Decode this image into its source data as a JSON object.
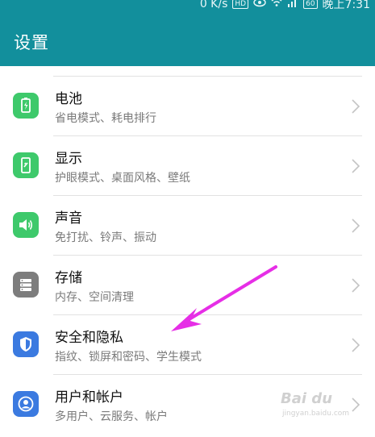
{
  "status_bar": {
    "speed": "0 K/s",
    "hd_label": "HD",
    "battery": "60",
    "time": "晚上7:31"
  },
  "header": {
    "title": "设置"
  },
  "settings": [
    {
      "title": "电池",
      "subtitle": "省电模式、耗电排行",
      "icon": "battery-icon",
      "color": "#3ec96b"
    },
    {
      "title": "显示",
      "subtitle": "护眼模式、桌面风格、壁纸",
      "icon": "display-icon",
      "color": "#3ec96b"
    },
    {
      "title": "声音",
      "subtitle": "免打扰、铃声、振动",
      "icon": "sound-icon",
      "color": "#3ec96b"
    },
    {
      "title": "存储",
      "subtitle": "内存、空间清理",
      "icon": "storage-icon",
      "color": "#7d7d7d"
    },
    {
      "title": "安全和隐私",
      "subtitle": "指纹、锁屏和密码、学生模式",
      "icon": "shield-icon",
      "color": "#3b7ae0"
    },
    {
      "title": "用户和帐户",
      "subtitle": "多用户、云服务、帐户",
      "icon": "user-icon",
      "color": "#3b7ae0"
    }
  ],
  "annotation": {
    "arrow_color": "#e62ee6"
  },
  "watermark": {
    "main": "Bai du",
    "sub": "jingyan.baidu.com"
  }
}
